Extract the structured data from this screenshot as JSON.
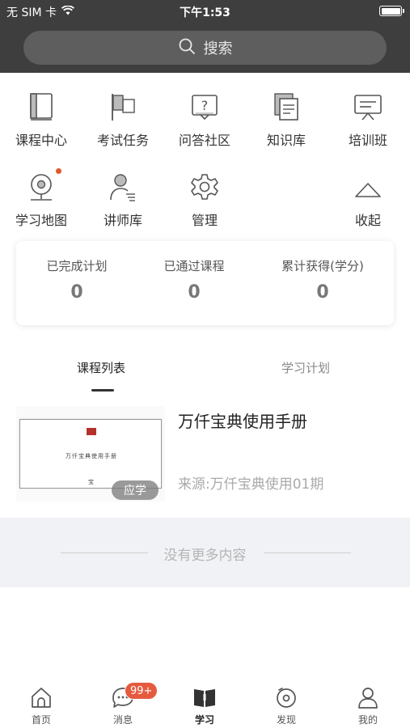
{
  "status_bar": {
    "carrier": "无 SIM 卡",
    "time": "下午1:53"
  },
  "search": {
    "placeholder": "搜索"
  },
  "grid": [
    {
      "label": "课程中心",
      "icon": "book-icon"
    },
    {
      "label": "考试任务",
      "icon": "flag-icon"
    },
    {
      "label": "问答社区",
      "icon": "question-icon"
    },
    {
      "label": "知识库",
      "icon": "documents-icon"
    },
    {
      "label": "培训班",
      "icon": "presentation-icon"
    },
    {
      "label": "学习地图",
      "icon": "map-pin-icon"
    },
    {
      "label": "讲师库",
      "icon": "lecturer-icon"
    },
    {
      "label": "管理",
      "icon": "gear-icon"
    },
    {
      "label": "收起",
      "icon": "chevron-up-icon"
    }
  ],
  "stats": [
    {
      "title": "已完成计划",
      "value": "0"
    },
    {
      "title": "已通过课程",
      "value": "0"
    },
    {
      "title": "累计获得(学分)",
      "value": "0"
    }
  ],
  "tabs": [
    {
      "label": "课程列表",
      "active": true
    },
    {
      "label": "学习计划",
      "active": false
    }
  ],
  "course": {
    "title": "万仟宝典使用手册",
    "source": "来源:万仟宝典使用01期",
    "badge": "应学",
    "thumb_title": "万仟宝典使用手册",
    "thumb_footer": "宝"
  },
  "list_end_text": "没有更多内容",
  "bottom_nav": [
    {
      "label": "首页",
      "icon": "home-icon"
    },
    {
      "label": "消息",
      "icon": "message-icon",
      "badge": "99+"
    },
    {
      "label": "学习",
      "icon": "study-book-icon",
      "active": true
    },
    {
      "label": "发现",
      "icon": "discover-icon"
    },
    {
      "label": "我的",
      "icon": "profile-icon"
    }
  ],
  "colors": {
    "header": "#3e3e3e",
    "badge": "#e55a3f",
    "red_dot": "#e4572e",
    "background_end": "#f1f2f5"
  }
}
